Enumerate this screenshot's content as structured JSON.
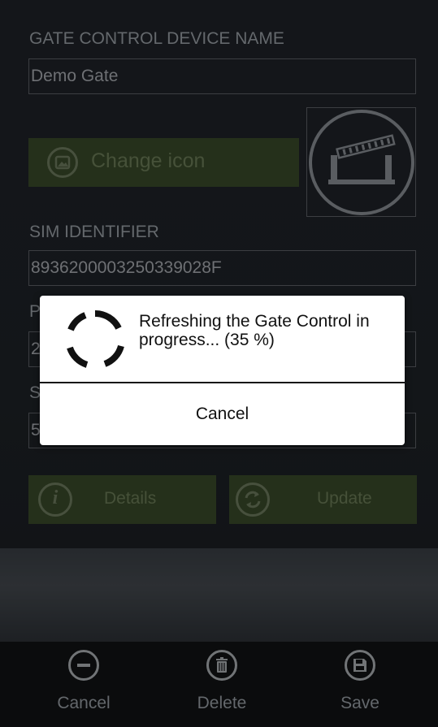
{
  "form": {
    "device_name_label": "GATE CONTROL DEVICE NAME",
    "device_name_value": "Demo Gate",
    "change_icon_label": "Change icon",
    "sim_identifier_label": "SIM IDENTIFIER",
    "sim_identifier_value": "8936200003250339028F",
    "field3_label_partial": "P",
    "field3_value_partial": "2",
    "field4_label_partial": "S",
    "field4_value_partial": "5",
    "details_label": "Details",
    "update_label": "Update"
  },
  "dialog": {
    "message": "Refreshing the Gate Control in progress... (35 %)",
    "progress_percent": 35,
    "cancel_label": "Cancel"
  },
  "bottom_bar": {
    "items": [
      {
        "label": "Cancel",
        "icon": "minus-circle-icon"
      },
      {
        "label": "Delete",
        "icon": "trash-icon"
      },
      {
        "label": "Save",
        "icon": "floppy-disk-icon"
      }
    ]
  },
  "colors": {
    "accent_green": "#3a4a2a",
    "background": "#1e2227",
    "dialog_bg": "#ffffff"
  }
}
